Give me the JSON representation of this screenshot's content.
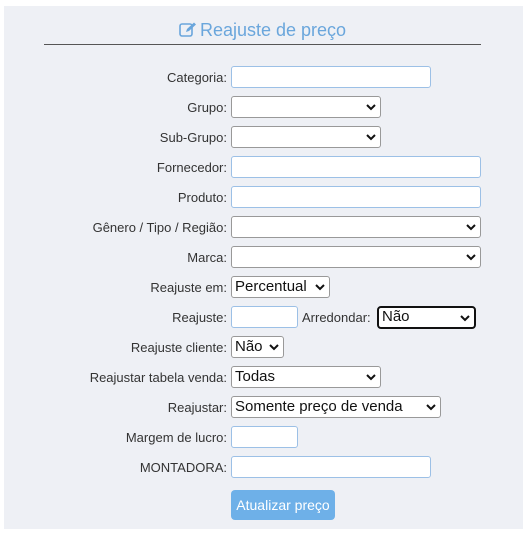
{
  "header": {
    "title": "Reajuste de preço",
    "icon": "edit-icon"
  },
  "fields": {
    "categoria": {
      "label": "Categoria:",
      "value": ""
    },
    "grupo": {
      "label": "Grupo:",
      "value": ""
    },
    "subgrupo": {
      "label": "Sub-Grupo:",
      "value": ""
    },
    "fornecedor": {
      "label": "Fornecedor:",
      "value": ""
    },
    "produto": {
      "label": "Produto:",
      "value": ""
    },
    "genero": {
      "label": "Gênero / Tipo / Região:",
      "value": ""
    },
    "marca": {
      "label": "Marca:",
      "value": ""
    },
    "reajuste_em": {
      "label": "Reajuste em:",
      "value": "Percentual"
    },
    "reajuste": {
      "label": "Reajuste:",
      "value": ""
    },
    "arredondar": {
      "label": "Arredondar:",
      "value": "Não"
    },
    "reajuste_cliente": {
      "label": "Reajuste cliente:",
      "value": "Não"
    },
    "tabela_venda": {
      "label": "Reajustar tabela venda:",
      "value": "Todas"
    },
    "reajustar": {
      "label": "Reajustar:",
      "value": "Somente preço de venda"
    },
    "margem": {
      "label": "Margem de lucro:",
      "value": ""
    },
    "montadora": {
      "label": "MONTADORA:",
      "value": ""
    }
  },
  "submit": {
    "label": "Atualizar preço"
  }
}
